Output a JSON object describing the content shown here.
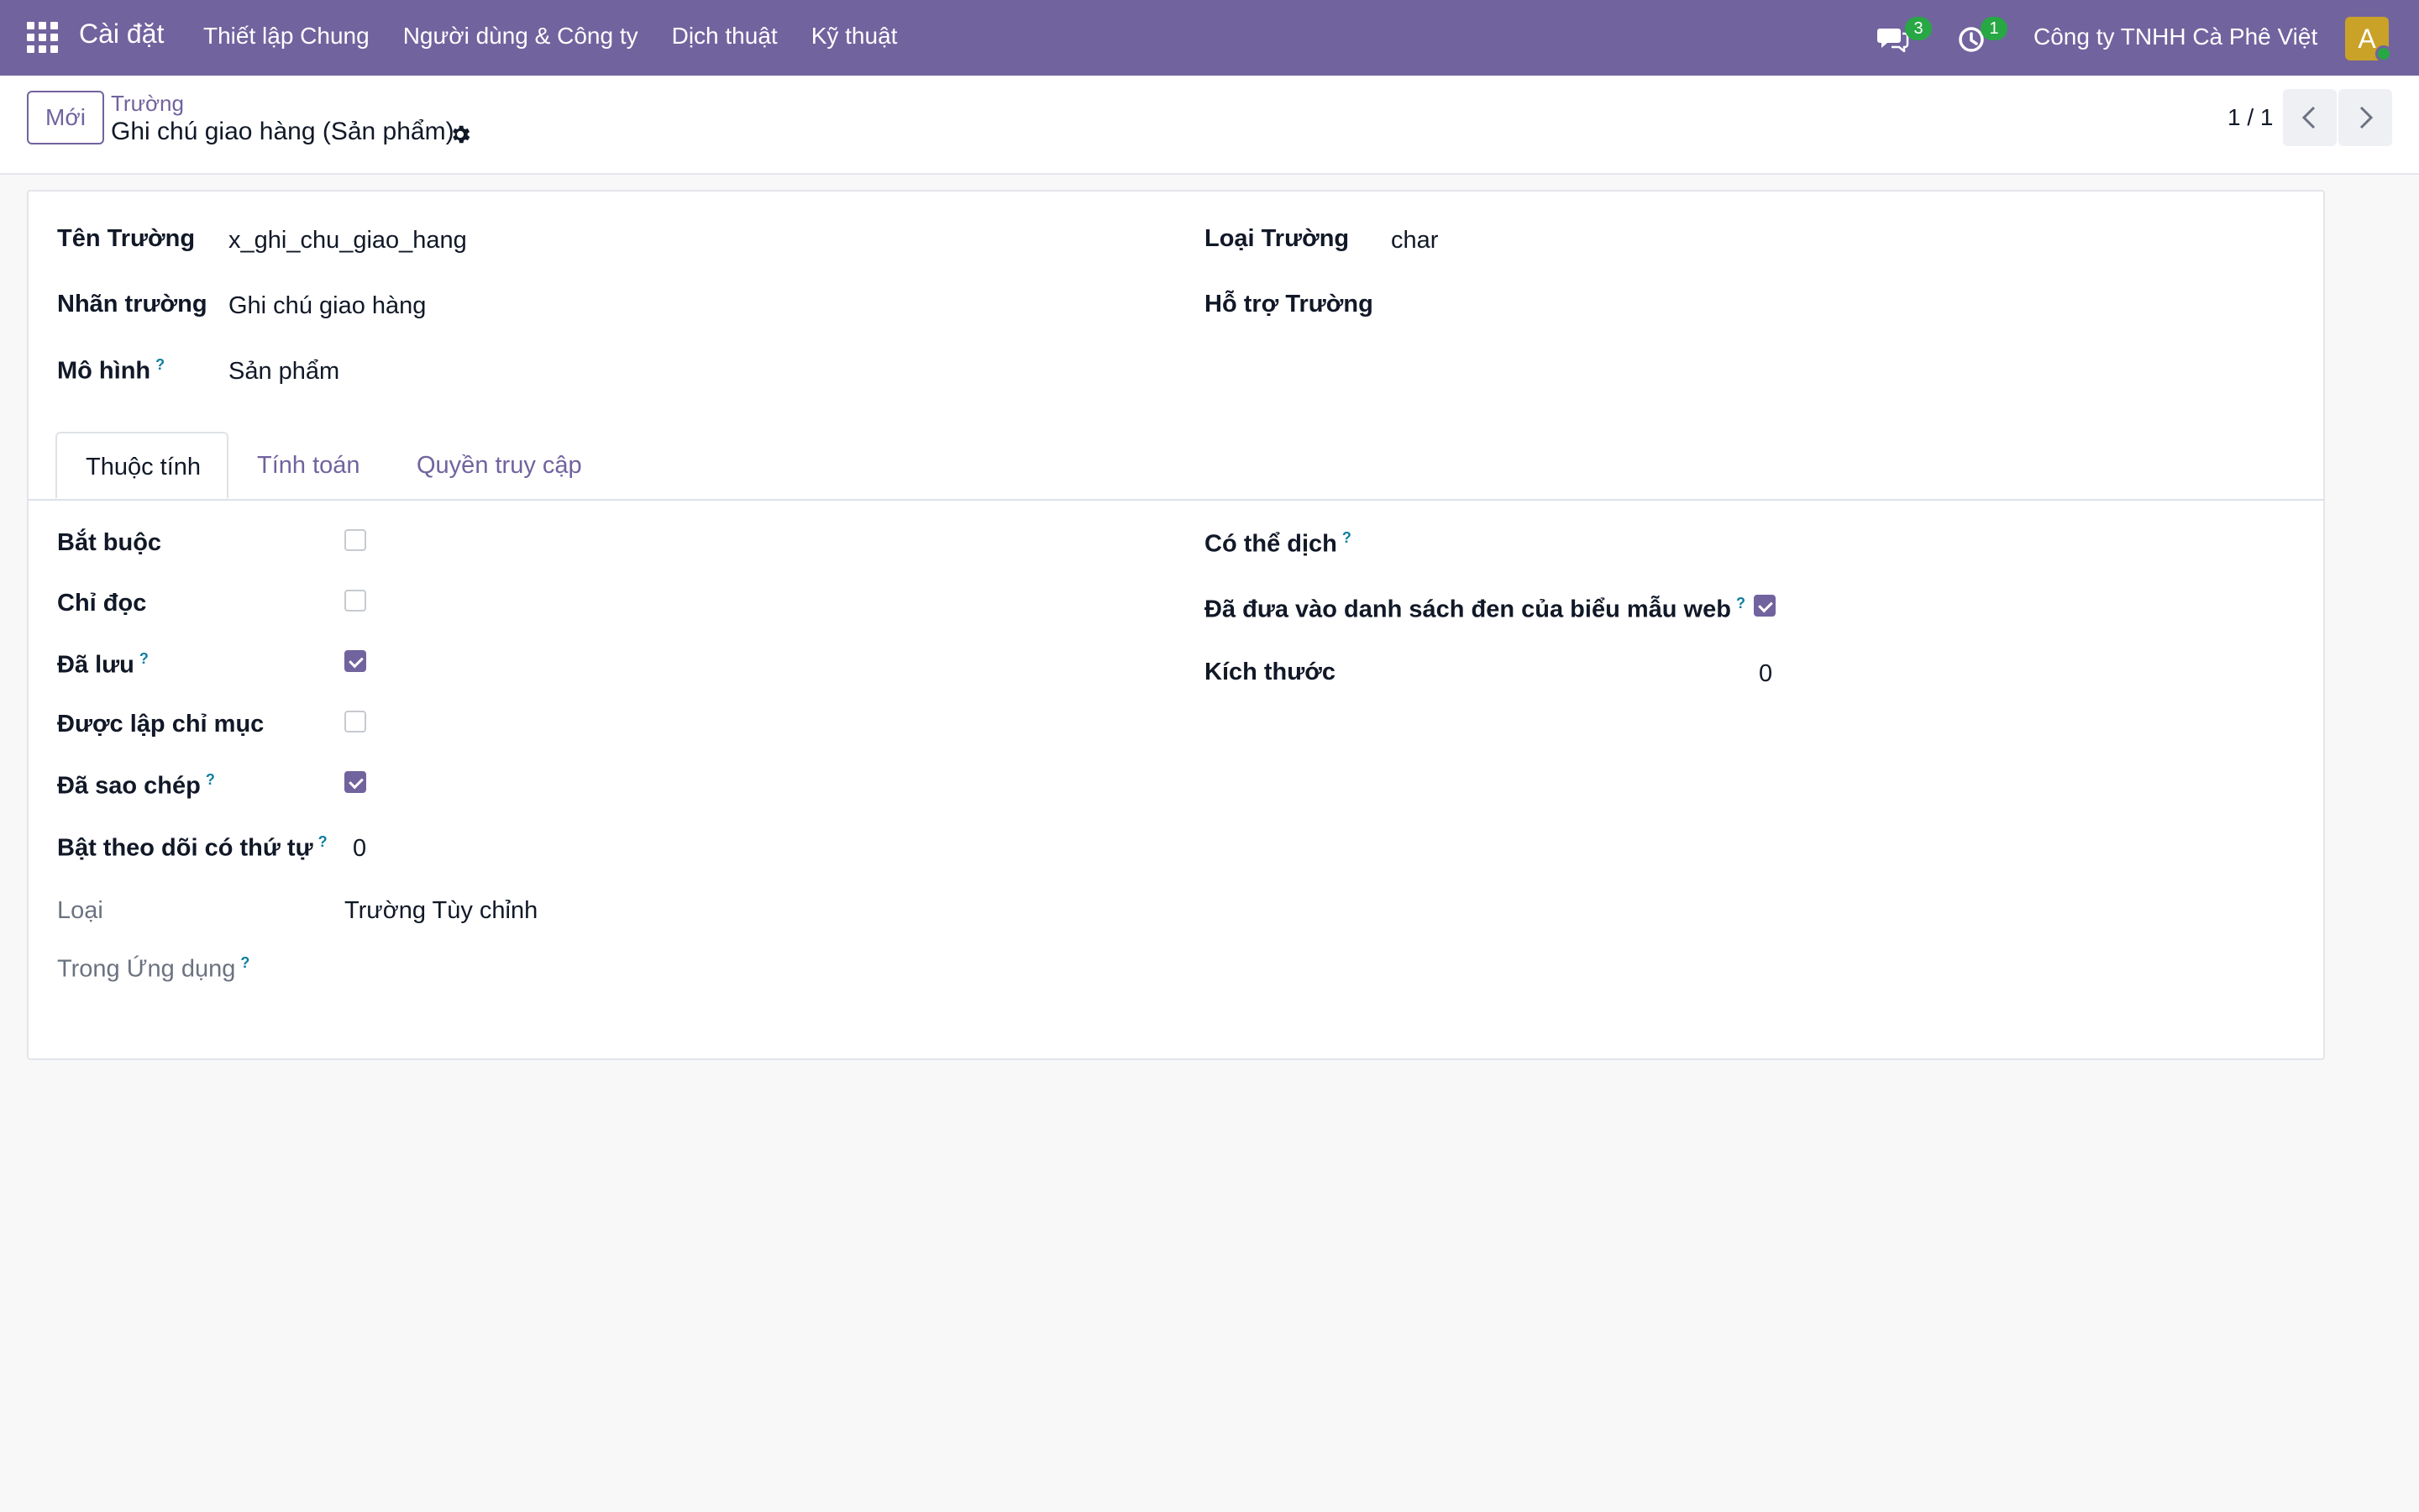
{
  "navbar": {
    "app_title": "Cài đặt",
    "menu": [
      "Thiết lập Chung",
      "Người dùng & Công ty",
      "Dịch thuật",
      "Kỹ thuật"
    ],
    "messages_count": "3",
    "activities_count": "1",
    "company": "Công ty TNHH Cà Phê Việt",
    "avatar_letter": "A"
  },
  "control": {
    "new_label": "Mới",
    "breadcrumb_parent": "Trường",
    "breadcrumb_current": "Ghi chú giao hàng (Sản phẩm)",
    "pager": "1 / 1"
  },
  "form": {
    "field_name_label": "Tên Trường",
    "field_name_value": "x_ghi_chu_giao_hang",
    "field_label_label": "Nhãn trường",
    "field_label_value": "Ghi chú giao hàng",
    "model_label": "Mô hình",
    "model_value": "Sản phẩm",
    "field_type_label": "Loại Trường",
    "field_type_value": "char",
    "field_help_label": "Hỗ trợ Trường"
  },
  "tabs": [
    "Thuộc tính",
    "Tính toán",
    "Quyền truy cập"
  ],
  "properties": {
    "required_label": "Bắt buộc",
    "readonly_label": "Chỉ đọc",
    "stored_label": "Đã lưu",
    "indexed_label": "Được lập chỉ mục",
    "copied_label": "Đã sao chép",
    "tracking_label": "Bật theo dõi có thứ tự",
    "tracking_value": "0",
    "type_label": "Loại",
    "type_value": "Trường Tùy chỉnh",
    "in_apps_label": "Trong Ứng dụng",
    "translate_label": "Có thể dịch",
    "blacklist_label": "Đã đưa vào danh sách đen của biểu mẫu web",
    "size_label": "Kích thước",
    "size_value": "0",
    "checks": {
      "required": false,
      "readonly": false,
      "stored": true,
      "indexed": false,
      "copied": true,
      "blacklisted": true
    }
  },
  "help_mark": "?",
  "colors": {
    "primary": "#71639e",
    "badge": "#28a745",
    "avatar": "#c9a227"
  },
  "icons": [
    "apps-icon",
    "chat-icon",
    "clock-icon",
    "gear-icon",
    "chevron-left-icon",
    "chevron-right-icon"
  ]
}
